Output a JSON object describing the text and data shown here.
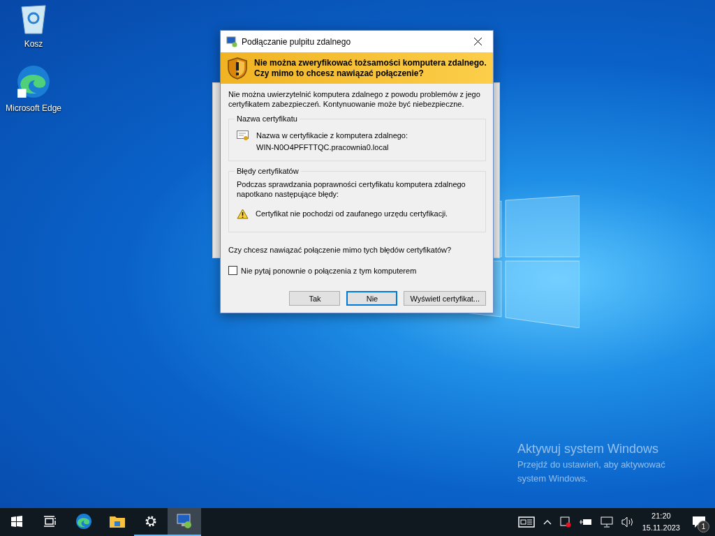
{
  "desktop_icons": [
    {
      "kind": "recycle-bin",
      "label": "Kosz"
    },
    {
      "kind": "edge",
      "label": "Microsoft Edge"
    }
  ],
  "dialog": {
    "title": "Podłączanie pulpitu zdalnego",
    "banner": [
      "Nie można zweryfikować tożsamości komputera zdalnego.",
      "Czy mimo to chcesz nawiązać połączenie?"
    ],
    "intro": "Nie można uwierzytelnić komputera zdalnego z powodu problemów z jego certyfikatem zabezpieczeń. Kontynuowanie może być niebezpieczne.",
    "groups": [
      {
        "kind": "certificate",
        "title": "Nazwa certyfikatu",
        "lines": [
          "Nazwa w certyfikacie z komputera zdalnego:",
          "WIN-N0O4PFFTTQC.pracownia0.local"
        ]
      },
      {
        "kind": "errors",
        "title": "Błędy certyfikatów",
        "lines": [
          "Podczas sprawdzania poprawności certyfikatu komputera zdalnego napotkano następujące błędy:",
          "Certyfikat nie pochodzi od zaufanego urzędu certyfikacji."
        ]
      }
    ],
    "question": "Czy chcesz nawiązać połączenie mimo tych błędów certyfikatów?",
    "checkbox": {
      "label": "Nie pytaj ponownie o połączenia z tym komputerem",
      "checked": false
    },
    "buttons": [
      {
        "label": "Tak",
        "selected": false
      },
      {
        "label": "Nie",
        "selected": true
      },
      {
        "label": "Wyświetl certyfikat...",
        "selected": false
      }
    ]
  },
  "activation": {
    "title": "Aktywuj system Windows",
    "text": "Przejdź do ustawień, aby aktywować system Windows."
  },
  "taskbar": {
    "apps": [
      {
        "kind": "start",
        "running": false,
        "selected": false
      },
      {
        "kind": "taskview",
        "running": false,
        "selected": false
      },
      {
        "kind": "edge",
        "running": false,
        "selected": false
      },
      {
        "kind": "explorer",
        "running": false,
        "selected": false
      },
      {
        "kind": "settings",
        "running": true,
        "selected": false
      },
      {
        "kind": "rdp",
        "running": true,
        "selected": true
      }
    ],
    "time": "21:20",
    "date": "15.11.2023",
    "notifications": "1"
  }
}
